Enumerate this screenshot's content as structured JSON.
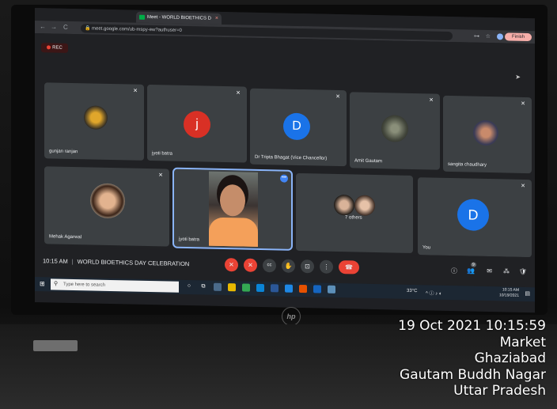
{
  "browser": {
    "tab_title": "Meet - WORLD BIOETHICS D",
    "url": "meet.google.com/ub-mspy-ew?authuser=0",
    "finish_label": "Finish",
    "tab_close": "×",
    "nav_back": "←",
    "nav_forward": "→",
    "nav_reload": "C",
    "lock": "🔒",
    "key_icon": "⊶",
    "star_icon": "☆"
  },
  "meet": {
    "rec_label": "REC",
    "participants": [
      {
        "name": "gunjan ranjan",
        "muted": true
      },
      {
        "name": "jyoti batra",
        "initial": "j",
        "avatar_color": "#d93025",
        "muted": true
      },
      {
        "name": "Dr Tripta Bhagat (Vice Chancellor)",
        "initial": "D",
        "avatar_color": "#1a73e8",
        "muted": true
      },
      {
        "name": "Amit Gautam",
        "muted": true
      },
      {
        "name": "sangita chaudhary",
        "muted": true
      },
      {
        "name": "Mehak Agarwal",
        "muted": true
      },
      {
        "name": "jyoti batra",
        "speaking": true
      },
      {
        "name": "7 others"
      },
      {
        "name": "You",
        "initial": "D",
        "avatar_color": "#1a73e8",
        "muted": true
      }
    ],
    "mic_off_icon": "✕",
    "more_icon": "•••"
  },
  "controls": {
    "time": "10:15 AM",
    "separator": "|",
    "meeting_title": "WORLD BIOETHICS DAY CELEBRATION",
    "mic_icon": "✕",
    "cam_icon": "✕",
    "cc_icon": "cc",
    "raise_hand_icon": "✋",
    "present_icon": "⊡",
    "more_icon": "⋮",
    "hangup_icon": "☎",
    "info_icon": "ⓘ",
    "people_icon": "👥",
    "people_count": "9",
    "chat_icon": "✉",
    "activities_icon": "⁂",
    "lock_icon": "🛡"
  },
  "taskbar": {
    "start_icon": "⊞",
    "search_placeholder": "Type here to search",
    "search_icon": "⚲",
    "weather": "33°C",
    "tray": "^ ⓘ ♪ ◐",
    "clock_time": "10:15 AM",
    "clock_date": "10/19/2021",
    "notif_icon": "▤"
  },
  "hp_logo": "hp",
  "stamp": {
    "datetime": "19 Oct 2021 10:15:59",
    "line2": "Market",
    "line3": "Ghaziabad",
    "line4": "Gautam Buddh Nagar",
    "line5": "Uttar Pradesh"
  }
}
